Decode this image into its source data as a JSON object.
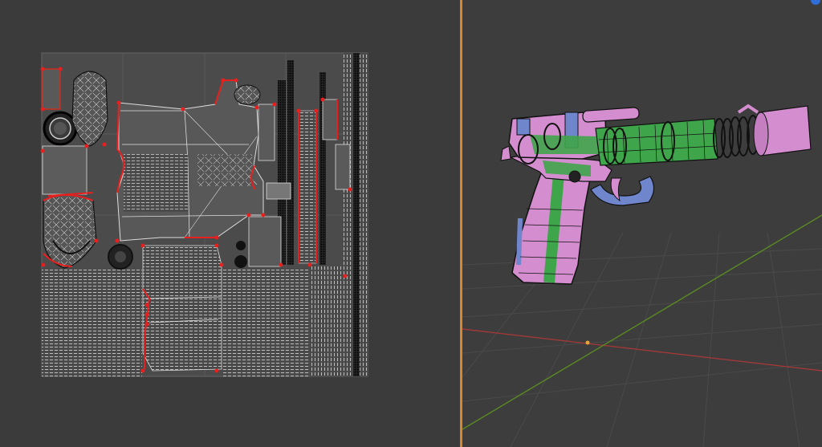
{
  "colors": {
    "background": "#3a3a3a",
    "uv_grid_bg": "#4a4a4a",
    "uv_lines": "#dcdcdc",
    "uv_seams": "#e81f1f",
    "uv_vertex": "#111111",
    "splitter": "#d8862a",
    "viewport_bg": "#3d3d3d",
    "x_axis": "#a23838",
    "y_axis": "#5a8a22",
    "origin": "#e8a43a",
    "mesh_pink": "#d48ecf",
    "mesh_blue": "#6f86cc",
    "mesh_green": "#3fa54a",
    "mesh_edges": "#111111",
    "corner_indicator": "#2e6ed8"
  },
  "uv_editor": {
    "name": "uv-editor-panel"
  },
  "viewport": {
    "name": "3d-viewport-panel",
    "object": "pistol-mesh"
  }
}
